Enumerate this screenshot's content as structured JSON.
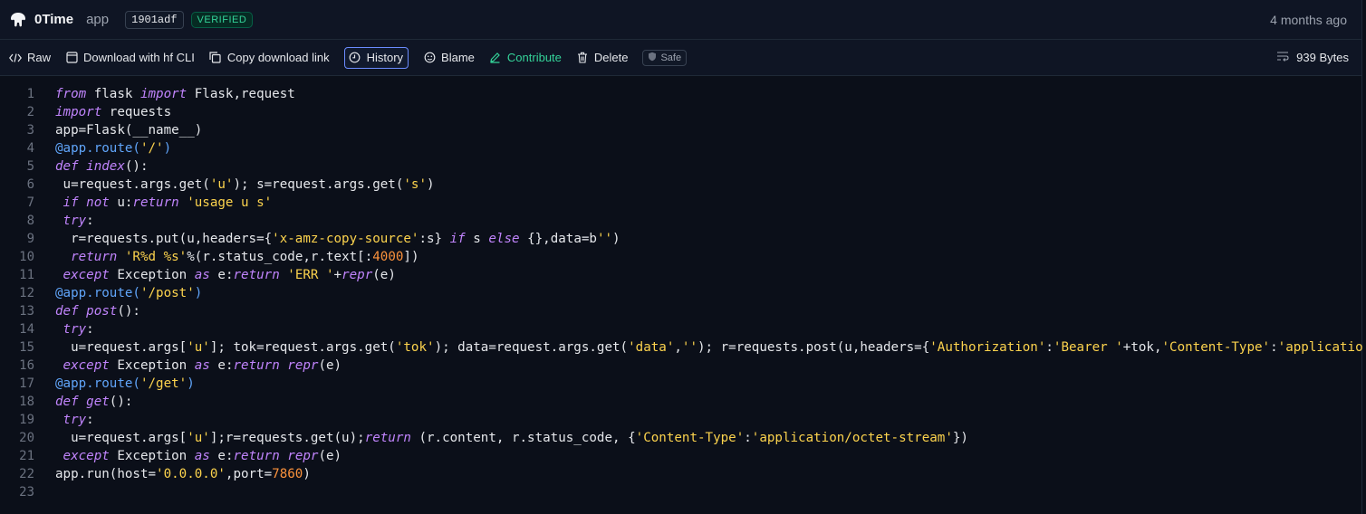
{
  "header": {
    "author": "0Time",
    "repo": "app",
    "commit": "1901adf",
    "verified": "VERIFIED",
    "time_ago": "4 months ago"
  },
  "toolbar": {
    "raw": "Raw",
    "download_cli": "Download with hf CLI",
    "copy_link": "Copy download link",
    "history": "History",
    "blame": "Blame",
    "contribute": "Contribute",
    "delete": "Delete",
    "safe": "Safe",
    "size": "939 Bytes"
  },
  "colors": {
    "accent_green": "#34d399",
    "keyword": "#c084fc",
    "string": "#fcd34d",
    "decorator": "#60a5fa",
    "number": "#fb923c"
  },
  "code": {
    "line_numbers": [
      "1",
      "2",
      "3",
      "4",
      "5",
      "6",
      "7",
      "8",
      "9",
      "10",
      "11",
      "12",
      "13",
      "14",
      "15",
      "16",
      "17",
      "18",
      "19",
      "20",
      "21",
      "22",
      "23"
    ],
    "lines": [
      [
        [
          "kw",
          "from"
        ],
        [
          "t",
          " flask "
        ],
        [
          "kw",
          "import"
        ],
        [
          "t",
          " Flask,request"
        ]
      ],
      [
        [
          "kw",
          "import"
        ],
        [
          "t",
          " requests"
        ]
      ],
      [
        [
          "t",
          "app=Flask(__name__)"
        ]
      ],
      [
        [
          "dec",
          "@app.route("
        ],
        [
          "str",
          "'/'"
        ],
        [
          "dec",
          ")"
        ]
      ],
      [
        [
          "kw",
          "def"
        ],
        [
          "t",
          " "
        ],
        [
          "fn",
          "index"
        ],
        [
          "t",
          "():"
        ]
      ],
      [
        [
          "t",
          " u=request.args.get("
        ],
        [
          "str",
          "'u'"
        ],
        [
          "t",
          "); s=request.args.get("
        ],
        [
          "str",
          "'s'"
        ],
        [
          "t",
          ")"
        ]
      ],
      [
        [
          "t",
          " "
        ],
        [
          "kw",
          "if not"
        ],
        [
          "t",
          " u:"
        ],
        [
          "kw",
          "return"
        ],
        [
          "t",
          " "
        ],
        [
          "str",
          "'usage u s'"
        ]
      ],
      [
        [
          "t",
          " "
        ],
        [
          "kw",
          "try"
        ],
        [
          "t",
          ":"
        ]
      ],
      [
        [
          "t",
          "  r=requests.put(u,headers={"
        ],
        [
          "str",
          "'x-amz-copy-source'"
        ],
        [
          "t",
          ":s} "
        ],
        [
          "kw",
          "if"
        ],
        [
          "t",
          " s "
        ],
        [
          "kw",
          "else"
        ],
        [
          "t",
          " {},data=b"
        ],
        [
          "str",
          "''"
        ],
        [
          "t",
          ")"
        ]
      ],
      [
        [
          "t",
          "  "
        ],
        [
          "kw",
          "return"
        ],
        [
          "t",
          " "
        ],
        [
          "str",
          "'R%d %s'"
        ],
        [
          "t",
          "%(r.status_code,r.text[:"
        ],
        [
          "num",
          "4000"
        ],
        [
          "t",
          "])"
        ]
      ],
      [
        [
          "t",
          " "
        ],
        [
          "kw",
          "except"
        ],
        [
          "t",
          " Exception "
        ],
        [
          "kw",
          "as"
        ],
        [
          "t",
          " e:"
        ],
        [
          "kw",
          "return"
        ],
        [
          "t",
          " "
        ],
        [
          "str",
          "'ERR '"
        ],
        [
          "t",
          "+"
        ],
        [
          "fn",
          "repr"
        ],
        [
          "t",
          "(e)"
        ]
      ],
      [
        [
          "dec",
          "@app.route("
        ],
        [
          "str",
          "'/post'"
        ],
        [
          "dec",
          ")"
        ]
      ],
      [
        [
          "kw",
          "def"
        ],
        [
          "t",
          " "
        ],
        [
          "fn",
          "post"
        ],
        [
          "t",
          "():"
        ]
      ],
      [
        [
          "t",
          " "
        ],
        [
          "kw",
          "try"
        ],
        [
          "t",
          ":"
        ]
      ],
      [
        [
          "t",
          "  u=request.args["
        ],
        [
          "str",
          "'u'"
        ],
        [
          "t",
          "]; tok=request.args.get("
        ],
        [
          "str",
          "'tok'"
        ],
        [
          "t",
          "); data=request.args.get("
        ],
        [
          "str",
          "'data'"
        ],
        [
          "t",
          ","
        ],
        [
          "str",
          "''"
        ],
        [
          "t",
          "); r=requests.post(u,headers={"
        ],
        [
          "str",
          "'Authorization'"
        ],
        [
          "t",
          ":"
        ],
        [
          "str",
          "'Bearer '"
        ],
        [
          "t",
          "+tok,"
        ],
        [
          "str",
          "'Content-Type'"
        ],
        [
          "t",
          ":"
        ],
        [
          "str",
          "'application/v"
        ]
      ],
      [
        [
          "t",
          " "
        ],
        [
          "kw",
          "except"
        ],
        [
          "t",
          " Exception "
        ],
        [
          "kw",
          "as"
        ],
        [
          "t",
          " e:"
        ],
        [
          "kw",
          "return"
        ],
        [
          "t",
          " "
        ],
        [
          "fn",
          "repr"
        ],
        [
          "t",
          "(e)"
        ]
      ],
      [
        [
          "dec",
          "@app.route("
        ],
        [
          "str",
          "'/get'"
        ],
        [
          "dec",
          ")"
        ]
      ],
      [
        [
          "kw",
          "def"
        ],
        [
          "t",
          " "
        ],
        [
          "fn",
          "get"
        ],
        [
          "t",
          "():"
        ]
      ],
      [
        [
          "t",
          " "
        ],
        [
          "kw",
          "try"
        ],
        [
          "t",
          ":"
        ]
      ],
      [
        [
          "t",
          "  u=request.args["
        ],
        [
          "str",
          "'u'"
        ],
        [
          "t",
          "];r=requests.get(u);"
        ],
        [
          "kw",
          "return"
        ],
        [
          "t",
          " (r.content, r.status_code, {"
        ],
        [
          "str",
          "'Content-Type'"
        ],
        [
          "t",
          ":"
        ],
        [
          "str",
          "'application/octet-stream'"
        ],
        [
          "t",
          "})"
        ]
      ],
      [
        [
          "t",
          " "
        ],
        [
          "kw",
          "except"
        ],
        [
          "t",
          " Exception "
        ],
        [
          "kw",
          "as"
        ],
        [
          "t",
          " e:"
        ],
        [
          "kw",
          "return"
        ],
        [
          "t",
          " "
        ],
        [
          "fn",
          "repr"
        ],
        [
          "t",
          "(e)"
        ]
      ],
      [
        [
          "t",
          "app.run(host="
        ],
        [
          "str",
          "'0.0.0.0'"
        ],
        [
          "t",
          ",port="
        ],
        [
          "num",
          "7860"
        ],
        [
          "t",
          ")"
        ]
      ],
      []
    ]
  }
}
